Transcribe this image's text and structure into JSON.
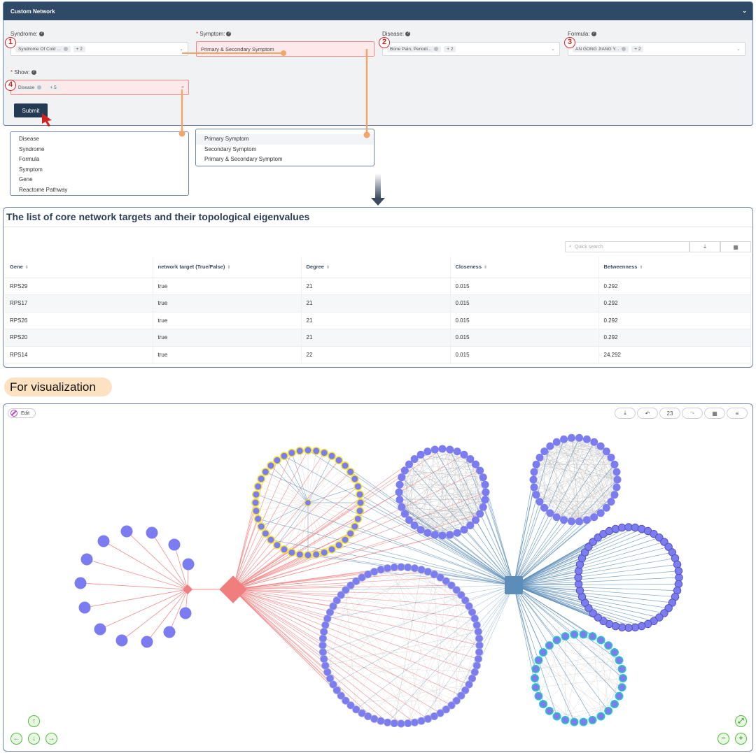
{
  "custom_network": {
    "title": "Custom Network",
    "syndrome": {
      "label": "Syndrome:",
      "tag": "Syndrome Of Cold ...",
      "more": "+ 2",
      "marker": "1"
    },
    "symptom": {
      "label": "Symptom:",
      "value": "Primary & Secondary Symptom"
    },
    "disease": {
      "label": "Disease:",
      "tag": "Bone Pain, Periodi...",
      "more": "+ 2",
      "marker": "2"
    },
    "formula": {
      "label": "Formula:",
      "tag": "AN GONG JIANG Y...",
      "more": "+ 2",
      "marker": "3"
    },
    "show": {
      "label": "Show:",
      "tag": "Disease",
      "more": "+ 5",
      "marker": "4"
    },
    "submit_label": "Submit",
    "required_mark": "*",
    "help_glyph": "?"
  },
  "show_options": [
    "Disease",
    "Syndrome",
    "Formula",
    "Symptom",
    "Gene",
    "Reactome Pathway"
  ],
  "symptom_options": [
    "Primary Symptom",
    "Secondary Symptom",
    "Primary & Secondary Symptom"
  ],
  "table": {
    "title": "The list of core network targets and their topological eigenvalues",
    "search_placeholder": "Quick search",
    "columns": [
      "Gene",
      "network target (True/False)",
      "Degree",
      "Closeness",
      "Betweenness"
    ],
    "rows": [
      [
        "RPS29",
        "true",
        "21",
        "0.015",
        "0.292"
      ],
      [
        "RPS17",
        "true",
        "21",
        "0.015",
        "0.292"
      ],
      [
        "RPS26",
        "true",
        "21",
        "0.015",
        "0.292"
      ],
      [
        "RPS20",
        "true",
        "21",
        "0.015",
        "0.292"
      ],
      [
        "RPS14",
        "true",
        "22",
        "0.015",
        "24.292"
      ]
    ]
  },
  "visualization": {
    "badge": "For visualization",
    "edit_label": "Edit",
    "counter": "23"
  },
  "colors": {
    "header": "#2f4a66",
    "node": "#7b7cf0",
    "red_edge": "#f07e7e",
    "blue_edge": "#5b8db8",
    "highlight_yellow": "#f4e33c",
    "highlight_cyan": "#28c7c7"
  }
}
